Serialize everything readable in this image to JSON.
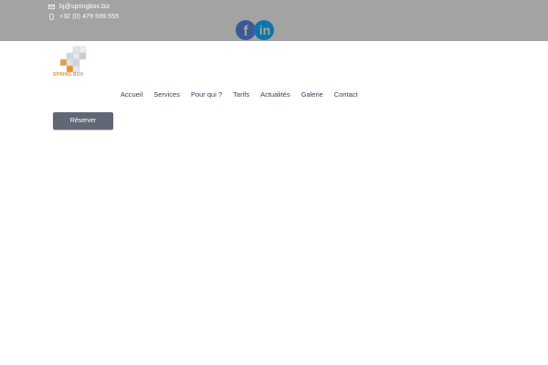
{
  "topbar": {
    "email": {
      "icon": "envelope-icon",
      "text": "bj@springbox.biz"
    },
    "phone": {
      "icon": "mobile-phone-icon",
      "text": "+32 (0) 479 599 555"
    },
    "social": [
      {
        "icon": "facebook-icon",
        "color": "#3b5998"
      },
      {
        "icon": "linkedin-icon",
        "color": "#0e76a8"
      }
    ],
    "background": "#a3a3a3"
  },
  "logo": {
    "brand_primary": "SPRING",
    "brand_secondary": "BOX",
    "accent_color": "#e8912c"
  },
  "nav": {
    "items": [
      {
        "label": "Accueil"
      },
      {
        "label": "Services"
      },
      {
        "label": "Pour qui ?"
      },
      {
        "label": "Tarifs"
      },
      {
        "label": "Actualités"
      },
      {
        "label": "Galerie"
      },
      {
        "label": "Contact"
      }
    ]
  },
  "cta": {
    "reserve_label": "Réserver",
    "color": "#616775"
  }
}
